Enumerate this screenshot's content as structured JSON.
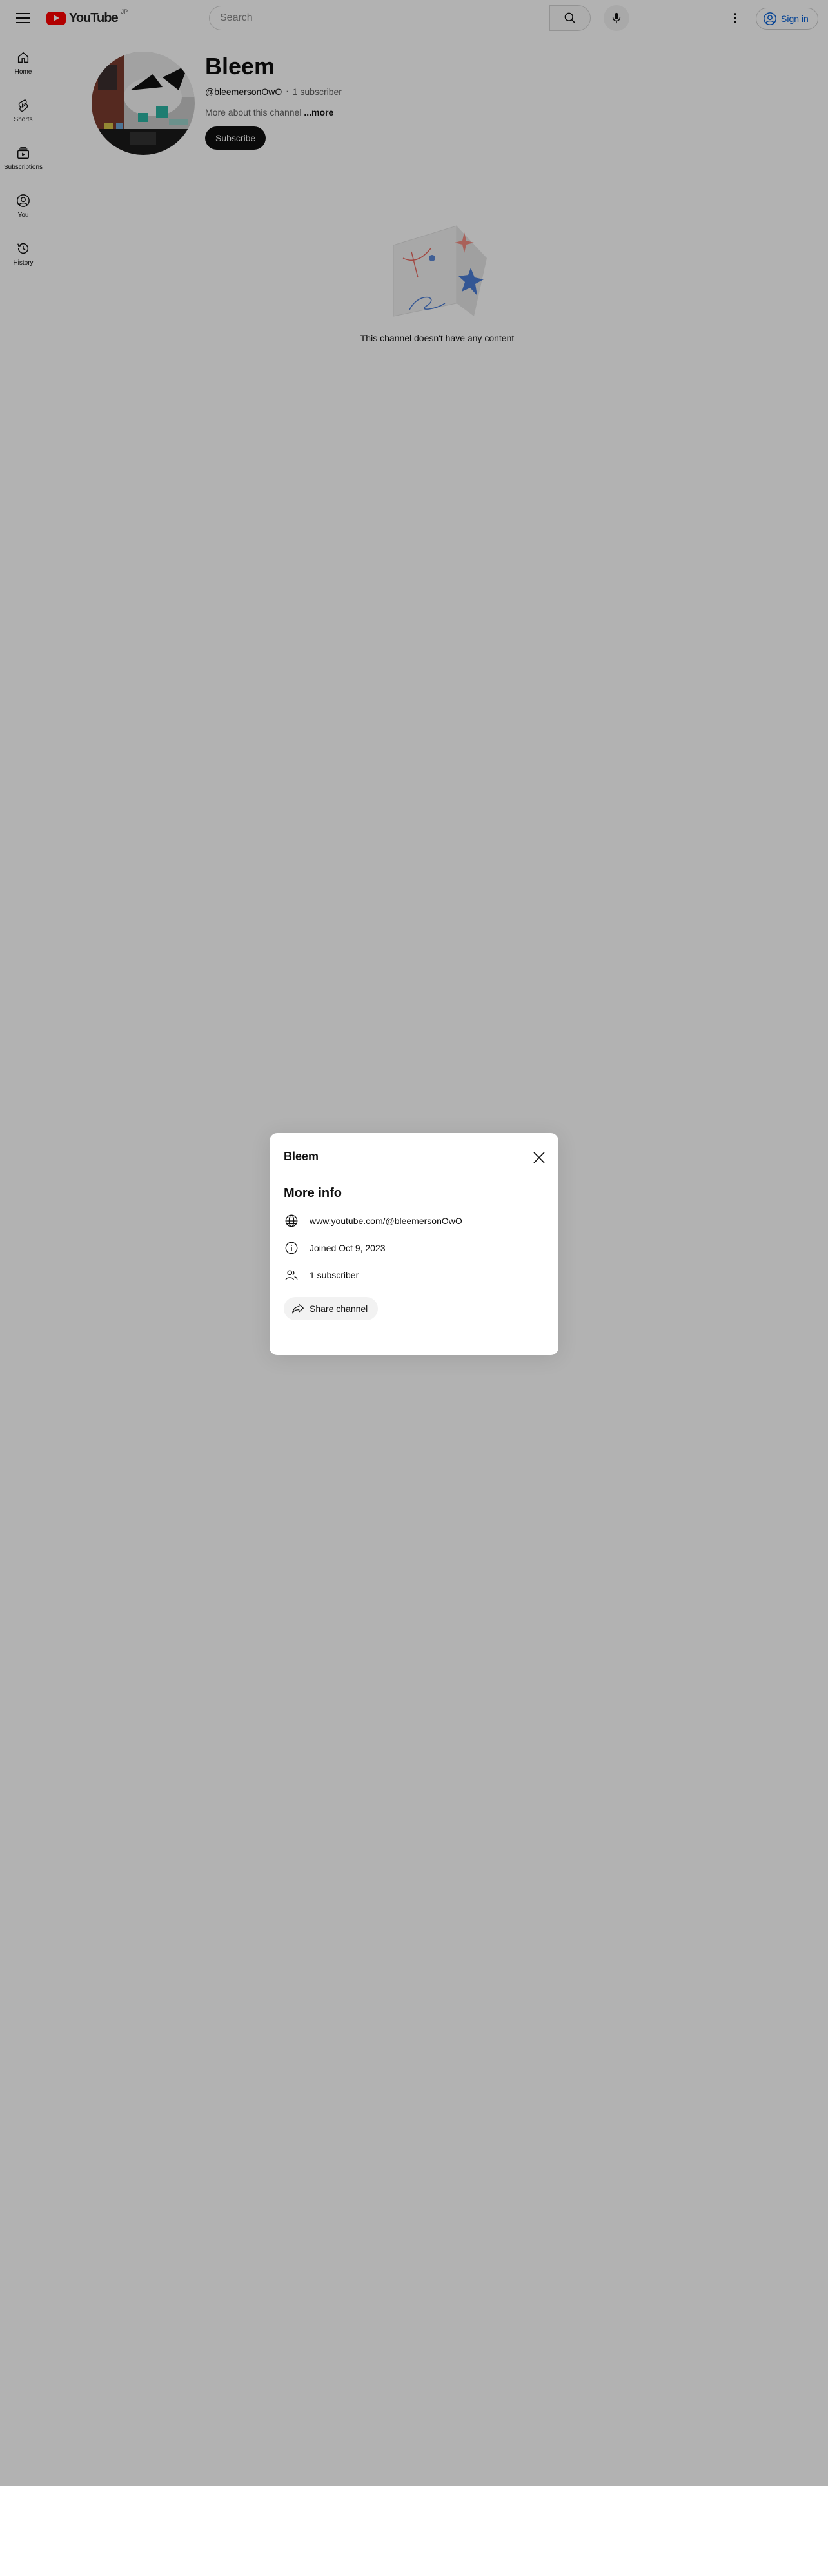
{
  "header": {
    "logo_text": "YouTube",
    "country_code": "JP",
    "search_placeholder": "Search",
    "signin_label": "Sign in"
  },
  "guide": {
    "items": [
      {
        "label": "Home",
        "icon": "home-icon"
      },
      {
        "label": "Shorts",
        "icon": "shorts-icon"
      },
      {
        "label": "Subscriptions",
        "icon": "subscriptions-icon"
      },
      {
        "label": "You",
        "icon": "you-icon"
      },
      {
        "label": "History",
        "icon": "history-icon"
      }
    ]
  },
  "channel": {
    "name": "Bleem",
    "handle": "@bleemersonOwO",
    "separator": "‧",
    "subscribers": "1 subscriber",
    "about": "More about this channel",
    "more_label": "...more",
    "subscribe_label": "Subscribe"
  },
  "empty_state": {
    "text": "This channel doesn't have any content"
  },
  "dialog": {
    "title": "Bleem",
    "subtitle": "More info",
    "link": "www.youtube.com/@bleemersonOwO",
    "joined": "Joined Oct 9, 2023",
    "subscribers": "1 subscriber",
    "share_label": "Share channel"
  },
  "colors": {
    "brand_red": "#ff0000",
    "link_blue": "#065fd4",
    "overlay": "rgba(0,0,0,0.30)"
  }
}
